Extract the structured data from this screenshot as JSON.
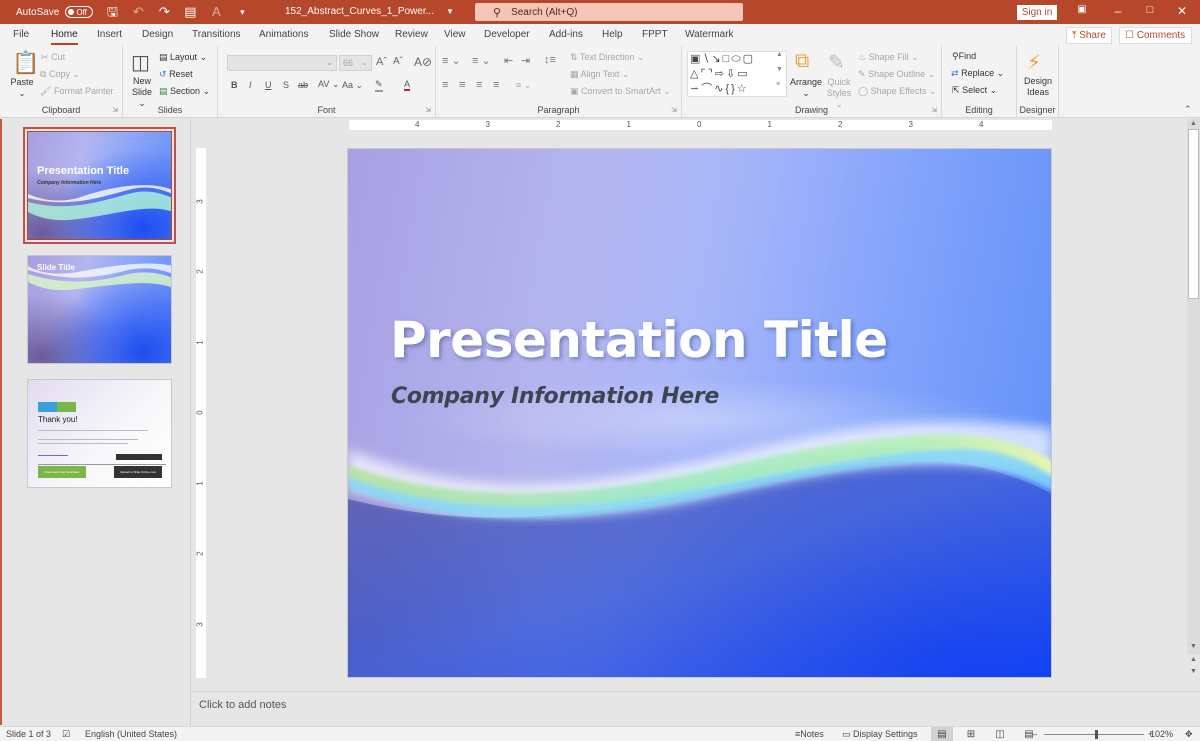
{
  "titlebar": {
    "autosave_label": "AutoSave",
    "autosave_state": "Off",
    "document_title": "152_Abstract_Curves_1_Power...",
    "search_placeholder": "Search (Alt+Q)",
    "sign_in": "Sign in"
  },
  "tabs": [
    "File",
    "Home",
    "Insert",
    "Design",
    "Transitions",
    "Animations",
    "Slide Show",
    "Review",
    "View",
    "Developer",
    "Add-ins",
    "Help",
    "FPPT",
    "Watermark"
  ],
  "active_tab": "Home",
  "actions": {
    "share": "Share",
    "comments": "Comments"
  },
  "ribbon": {
    "clipboard": {
      "label": "Clipboard",
      "paste": "Paste",
      "cut": "Cut",
      "copy": "Copy",
      "format_painter": "Format Painter"
    },
    "slides": {
      "label": "Slides",
      "new_slide_1": "New",
      "new_slide_2": "Slide",
      "layout": "Layout",
      "reset": "Reset",
      "section": "Section"
    },
    "font": {
      "label": "Font",
      "font_name": "",
      "font_size": "66"
    },
    "paragraph": {
      "label": "Paragraph",
      "text_direction": "Text Direction",
      "align_text": "Align Text",
      "convert_smartart": "Convert to SmartArt"
    },
    "drawing": {
      "label": "Drawing",
      "arrange": "Arrange",
      "quick_styles_1": "Quick",
      "quick_styles_2": "Styles",
      "shape_fill": "Shape Fill",
      "shape_outline": "Shape Outline",
      "shape_effects": "Shape Effects"
    },
    "editing": {
      "label": "Editing",
      "find": "Find",
      "replace": "Replace",
      "select": "Select"
    },
    "designer": {
      "label": "Designer",
      "design_ideas_1": "Design",
      "design_ideas_2": "Ideas"
    }
  },
  "thumbnails": [
    {
      "number": "1",
      "title": "Presentation Title",
      "subtitle": "Company Information Here",
      "selected": true
    },
    {
      "number": "2",
      "title": "Slide Title",
      "selected": false
    },
    {
      "number": "3",
      "title": "Thank you!",
      "button_left": "Download Free Templates",
      "button_right": "Upload to Slide Online.com",
      "selected": false
    }
  ],
  "ruler": {
    "horizontal": [
      "4",
      "3",
      "2",
      "1",
      "0",
      "1",
      "2",
      "3",
      "4"
    ],
    "vertical": [
      "3",
      "2",
      "1",
      "0",
      "1",
      "2",
      "3"
    ]
  },
  "slide": {
    "title": "Presentation Title",
    "subtitle": "Company Information Here"
  },
  "notes_placeholder": "Click to add notes",
  "statusbar": {
    "slide_counter": "Slide 1 of 3",
    "language": "English (United States)",
    "notes": "Notes",
    "display_settings": "Display Settings",
    "zoom_level": "102%",
    "zoom_fraction": 0.52
  },
  "colors": {
    "accent": "#b7472a",
    "title_text": "#ffffff",
    "subtitle_text": "#3f4450"
  }
}
